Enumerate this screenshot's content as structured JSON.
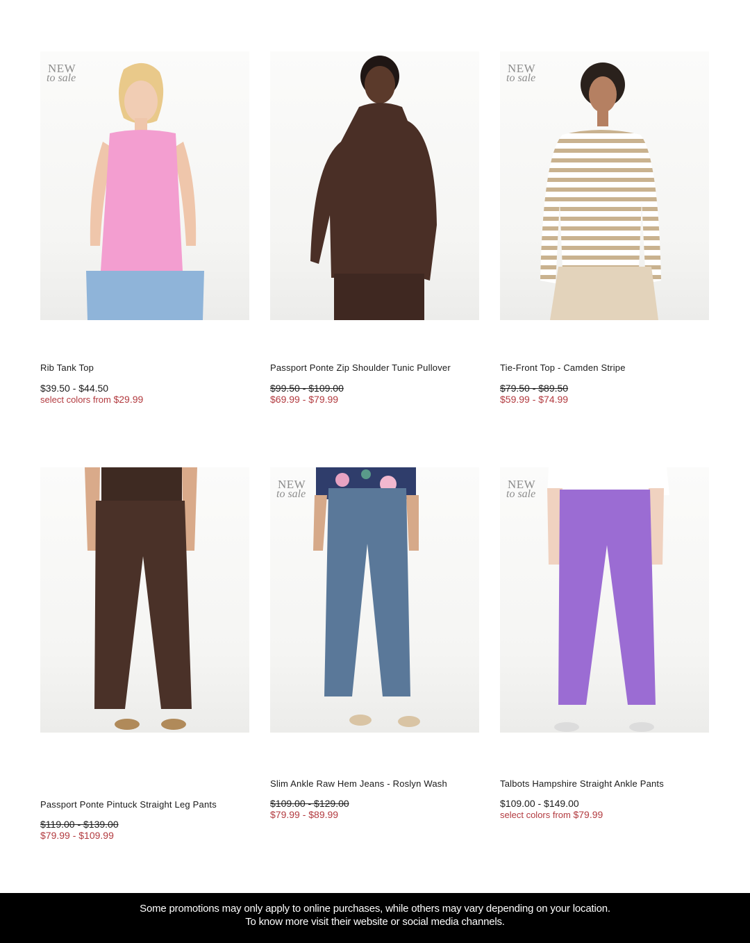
{
  "badge": {
    "line1": "NEW",
    "line2": "to sale"
  },
  "products": [
    {
      "name": "Rib Tank Top",
      "price": "$39.50 - $44.50",
      "sale_prefix": "select colors from ",
      "sale": "$29.99",
      "badge": true
    },
    {
      "name": "Passport Ponte Zip Shoulder Tunic Pullover",
      "price": "$99.50 - $109.00",
      "sale_prefix": "",
      "sale": "$69.99 - $79.99",
      "badge": false
    },
    {
      "name": "Tie-Front Top - Camden Stripe",
      "price": "$79.50 - $89.50",
      "sale_prefix": "",
      "sale": "$59.99 - $74.99",
      "badge": true
    },
    {
      "name": "Passport Ponte Pintuck Straight Leg Pants",
      "price": "$119.00 - $139.00",
      "sale_prefix": "",
      "sale": "$79.99 - $109.99",
      "badge": false
    },
    {
      "name": "Slim Ankle Raw Hem Jeans - Roslyn Wash",
      "price": "$109.00 - $129.00",
      "sale_prefix": "",
      "sale": "$79.99 - $89.99",
      "badge": true
    },
    {
      "name": "Talbots Hampshire Straight Ankle Pants",
      "price": "$109.00 - $149.00",
      "sale_prefix": "select colors from ",
      "sale": "$79.99",
      "badge": true
    }
  ],
  "footer": {
    "line1": "Some promotions may only apply to online purchases, while others may vary depending on your location.",
    "line2": "To know more visit their website or social media channels."
  }
}
